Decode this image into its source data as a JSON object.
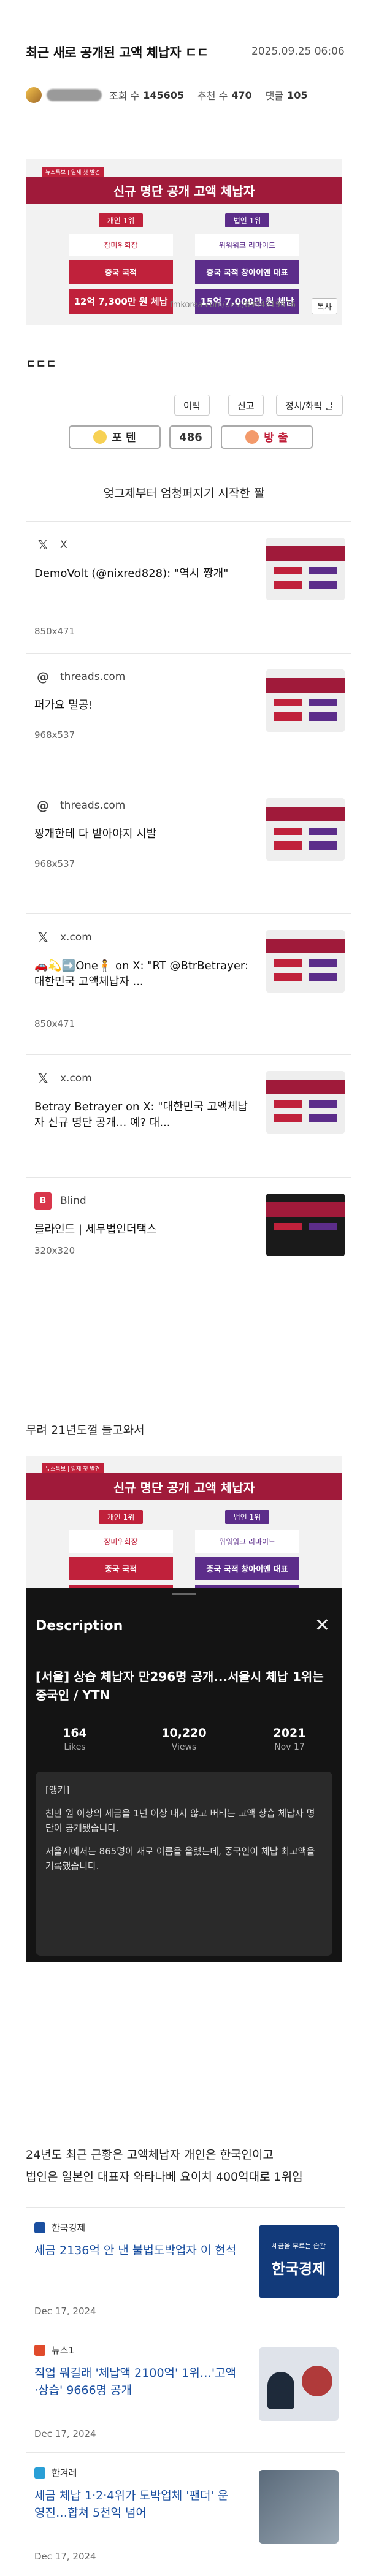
{
  "post": {
    "title": "최근 새로 공개된 고액 체납자 ㄷㄷ",
    "date": "2025.09.25 06:06",
    "views_label": "조회 수",
    "views": "145605",
    "likes_label": "추천 수",
    "likes": "470",
    "comments_label": "댓글",
    "comments": "105"
  },
  "banner": {
    "tag": "뉴스특보 | 일제 첫 발견",
    "headline": "신규 명단 공개 고액 체납자",
    "left": {
      "rank": "개인 1위",
      "name": "장미위회장",
      "nation": "중국 국적",
      "amount": "12억 7,300만 원 체납"
    },
    "right": {
      "rank": "법인 1위",
      "name": "위워워크 리마이드",
      "nation": "중국 국적 창아이엔 대표",
      "amount": "15억 7,000만 원 체납"
    },
    "source": "fmkorea.com/best/8954919676",
    "copy_label": "복사"
  },
  "reaction": "ㄷㄷㄷ",
  "actions": {
    "list": "이력",
    "report": "신고",
    "edit": "정치/화력 글"
  },
  "votes": {
    "up_label": "포 텐",
    "count": "486",
    "down_label": "방 출"
  },
  "section1": "엊그제부터 엄청퍼지기 시작한 짤",
  "cards": [
    {
      "site": "X",
      "title": "DemoVolt (@nixred828): \"역시 짱개\"",
      "meta": "850x471"
    },
    {
      "site": "threads.com",
      "title": "퍼가요 멸공!",
      "meta": "968x537"
    },
    {
      "site": "threads.com",
      "title": "짱개한테 다 받아야지 시발",
      "meta": "968x537"
    },
    {
      "site": "x.com",
      "title": "🚗💫➡️One🧍 on X: \"RT @BtrBetrayer: 대한민국 고액체납자 ...",
      "meta": "850x471"
    },
    {
      "site": "x.com",
      "title": "Betray Betrayer on X: \"대한민국 고액체납자 신규 명단 공개... 예? 대...",
      "meta": "850x471"
    },
    {
      "site": "Blind",
      "title": "블라인드 | 세무법인더택스",
      "meta": "320x320"
    }
  ],
  "body1": "무려 21년도껄 들고와서",
  "video": {
    "section": "Description",
    "title": "[서울] 상습 체납자 만296명 공개...서울시 체납 1위는 중국인 / YTN",
    "likes": "164",
    "likes_label": "Likes",
    "views": "10,220",
    "views_label": "Views",
    "year": "2021",
    "date": "Nov 17",
    "desc1": "[앵커]",
    "desc2": "천만 원 이상의 세금을 1년 이상 내지 않고 버티는 고액 상습 체납자 명단이 공개됐습니다.",
    "desc3": "서울시에서는 865명이 새로 이름을 올렸는데, 중국인이 체납 최고액을 기록했습니다."
  },
  "body2": "24년도 최근 근황은 고액체납자 개인은 한국인이고",
  "body3": "법인은 일본인 대표자 와타나베 요이치 400억대로 1위임",
  "news": [
    {
      "source": "한국경제",
      "title": "세금 2136억 안 낸 불법도박업자 이 현석",
      "date": "Dec 17, 2024",
      "thumb_text": "한국경제",
      "thumb_sub": "세금을 부르는 습관"
    },
    {
      "source": "뉴스1",
      "title": "직업 뭐길래 '체납액 2100억' 1위…'고액·상습' 9666명 공개",
      "date": "Dec 17, 2024"
    },
    {
      "source": "한겨레",
      "title": "세금 체납 1·2·4위가 도박업체 '팬더' 운영진…합쳐 5천억 넘어",
      "date": "Dec 17, 2024"
    }
  ]
}
